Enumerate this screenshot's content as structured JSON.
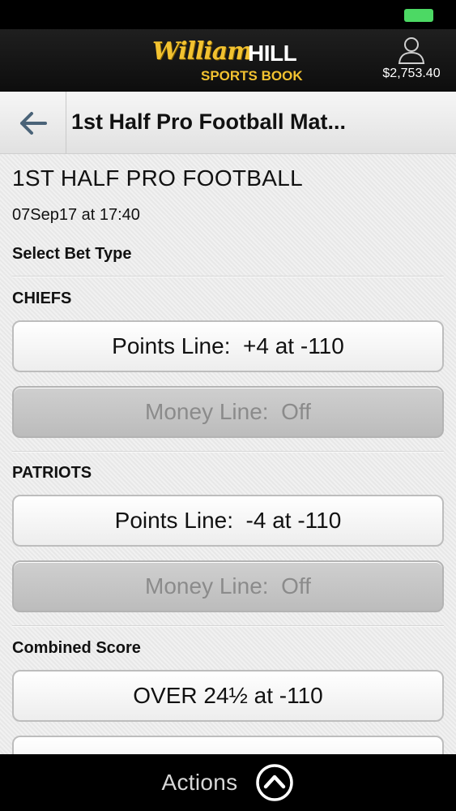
{
  "header": {
    "logo_script": "William",
    "logo_hill": "HILL",
    "logo_sub": "SPORTS BOOK",
    "balance": "$2,753.40"
  },
  "nav": {
    "title": "1st Half Pro Football Mat..."
  },
  "event": {
    "title": "1ST HALF PRO FOOTBALL",
    "date": "07Sep17 at 17:40",
    "select_label": "Select Bet Type"
  },
  "sections": {
    "chiefs": {
      "label": "CHIEFS",
      "points_line": "Points Line:  +4 at -110",
      "money_line": "Money Line:  Off"
    },
    "patriots": {
      "label": "PATRIOTS",
      "points_line": "Points Line:  -4 at -110",
      "money_line": "Money Line:  Off"
    },
    "combined": {
      "label": "Combined Score",
      "over": "OVER 24½ at -110"
    }
  },
  "actions": {
    "label": "Actions"
  },
  "colors": {
    "brand_gold": "#f2c230",
    "battery_green": "#4cd964"
  }
}
